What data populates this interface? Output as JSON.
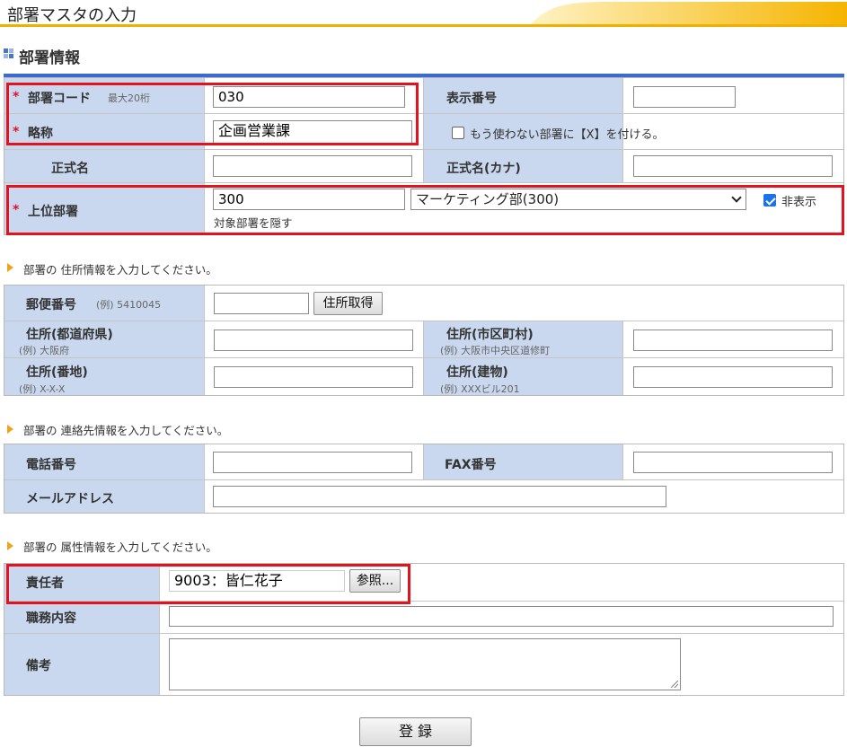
{
  "header": {
    "title": "部署マスタの入力"
  },
  "section": {
    "title": "部署情報"
  },
  "dept": {
    "code_label": "部署コード",
    "code_hint": "最大20桁",
    "code_value": "030",
    "display_no_label": "表示番号",
    "display_no_value": "",
    "short_label": "略称",
    "short_value": "企画営業課",
    "retire_checkbox_label": "もう使わない部署に【X】を付ける。",
    "retire_checked": false,
    "official_label": "正式名",
    "official_value": "",
    "official_kana_label": "正式名(カナ)",
    "official_kana_value": "",
    "parent_label": "上位部署",
    "parent_code": "300",
    "parent_select": "マーケティング部(300)",
    "hide_label": "非表示",
    "hide_checked": true,
    "hide_note": "対象部署を隠す",
    "required_mark": "*"
  },
  "address": {
    "note": "部署の 住所情報を入力してください。",
    "postal_label": "郵便番号",
    "postal_example": "(例) 5410045",
    "postal_value": "",
    "lookup_button": "住所取得",
    "pref_label": "住所(都道府県)",
    "pref_example": "(例) 大阪府",
    "city_label": "住所(市区町村)",
    "city_example": "(例) 大阪市中央区道修町",
    "block_label": "住所(番地)",
    "block_example": "(例) X-X-X",
    "building_label": "住所(建物)",
    "building_example": "(例) XXXビル201"
  },
  "contact": {
    "note": "部署の 連絡先情報を入力してください。",
    "phone_label": "電話番号",
    "fax_label": "FAX番号",
    "mail_label": "メールアドレス"
  },
  "attributes": {
    "note": "部署の 属性情報を入力してください。",
    "manager_label": "責任者",
    "manager_value": "9003：皆仁花子",
    "browse_button": "参照...",
    "duties_label": "職務内容",
    "remarks_label": "備考"
  },
  "actions": {
    "register_button": "登 録"
  },
  "colors": {
    "label_bg": "#c9d8ee",
    "accent_rule": "#3b6bd0",
    "highlight": "#e3131e",
    "header_gradient": "#f7b800"
  }
}
